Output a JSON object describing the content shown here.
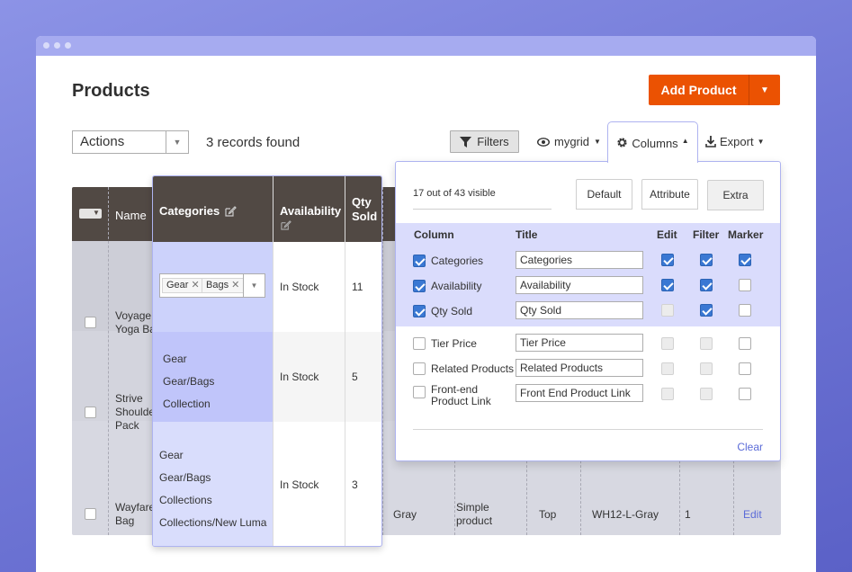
{
  "page": {
    "title": "Products"
  },
  "add_product": {
    "label": "Add Product"
  },
  "toolbar": {
    "actions": "Actions",
    "records": "3 records found",
    "filters": "Filters",
    "view": "mygrid",
    "columns": "Columns",
    "export": "Export"
  },
  "grid": {
    "header_name": "Name",
    "rows": [
      {
        "name_lines": [
          "Voyage",
          "Yoga Ba"
        ]
      },
      {
        "name_lines": [
          "Strive",
          "Shoulde",
          "Pack"
        ]
      },
      {
        "name_lines": [
          "Wayfare",
          "Bag"
        ],
        "color": "Gray",
        "type_lines": [
          "Simple",
          "product"
        ],
        "position": "Top",
        "sku": "WH12-L-Gray",
        "count": "1",
        "action": "Edit"
      }
    ]
  },
  "category_overlay": {
    "headers": {
      "categories": "Categories",
      "availability": "Availability",
      "qty_line1": "Qty",
      "qty_line2": "Sold"
    },
    "rows": [
      {
        "tags": [
          "Gear",
          "Bags"
        ],
        "availability": "In Stock",
        "qty": "11"
      },
      {
        "categories": [
          "Gear",
          "Gear/Bags",
          "Collection"
        ],
        "availability": "In Stock",
        "qty": "5"
      },
      {
        "categories": [
          "Gear",
          "Gear/Bags",
          "Collections",
          "Collections/New Luma"
        ],
        "availability": "In Stock",
        "qty": "3"
      }
    ]
  },
  "columns_panel": {
    "visible_count": "17 out of 43 visible",
    "tabs": [
      "Default",
      "Attribute",
      "Extra"
    ],
    "headers": {
      "column": "Column",
      "title": "Title",
      "edit": "Edit",
      "filter": "Filter",
      "marker": "Marker"
    },
    "rows": [
      {
        "label": "Categories",
        "title": "Categories",
        "checked": true,
        "edit": "on",
        "filter": "on",
        "marker": "on"
      },
      {
        "label": "Availability",
        "title": "Availability",
        "checked": true,
        "edit": "on",
        "filter": "on",
        "marker": "off"
      },
      {
        "label": "Qty Sold",
        "title": "Qty Sold",
        "checked": true,
        "edit": "disabled",
        "filter": "on",
        "marker": "off"
      },
      {
        "label": "Tier Price",
        "title": "Tier Price",
        "checked": false,
        "edit": "disabled",
        "filter": "disabled",
        "marker": "off"
      },
      {
        "label": "Related Products",
        "title": "Related Products",
        "checked": false,
        "edit": "disabled",
        "filter": "disabled",
        "marker": "off"
      },
      {
        "label_line1": "Front-end",
        "label_line2": "Product Link",
        "title": "Front End Product Link",
        "checked": false,
        "edit": "disabled",
        "filter": "disabled",
        "marker": "off"
      }
    ],
    "clear": "Clear"
  },
  "colors": {
    "accent": "#eb5202",
    "header": "#514944",
    "link": "#5b6bd8",
    "checkbox": "#3a78d3"
  }
}
